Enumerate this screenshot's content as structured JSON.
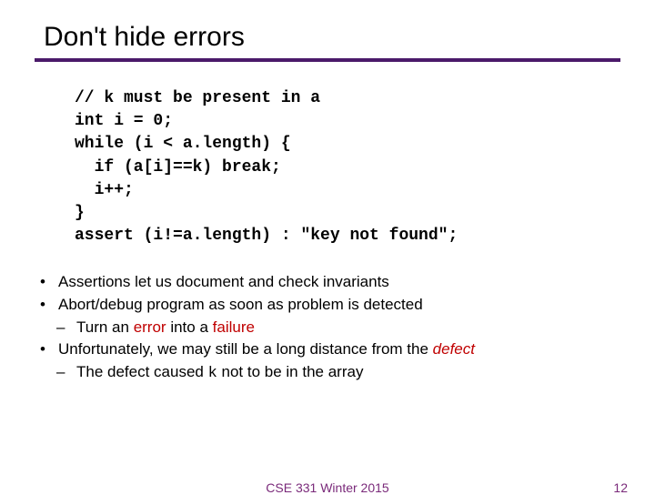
{
  "title": "Don't hide errors",
  "code": {
    "l1": "// k must be present in a",
    "l2": "int i = 0;",
    "l3": "while (i < a.length) {",
    "l4": "  if (a[i]==k) break;",
    "l5": "  i++;",
    "l6": "}",
    "l7": "assert (i!=a.length) : \"key not found\";"
  },
  "bul": {
    "a": "Assertions let us document and check invariants",
    "b": "Abort/debug program as soon as problem is detected",
    "c_pre": "Turn an ",
    "c_err": "error",
    "c_mid": " into a ",
    "c_fail": "failure",
    "d_pre": "Unfortunately, we may still be a long distance from the ",
    "d_def": "defect",
    "e_pre": "The defect caused ",
    "e_k": "k",
    "e_post": " not to be in the array"
  },
  "footer": {
    "center": "CSE 331 Winter 2015",
    "page": "12"
  }
}
